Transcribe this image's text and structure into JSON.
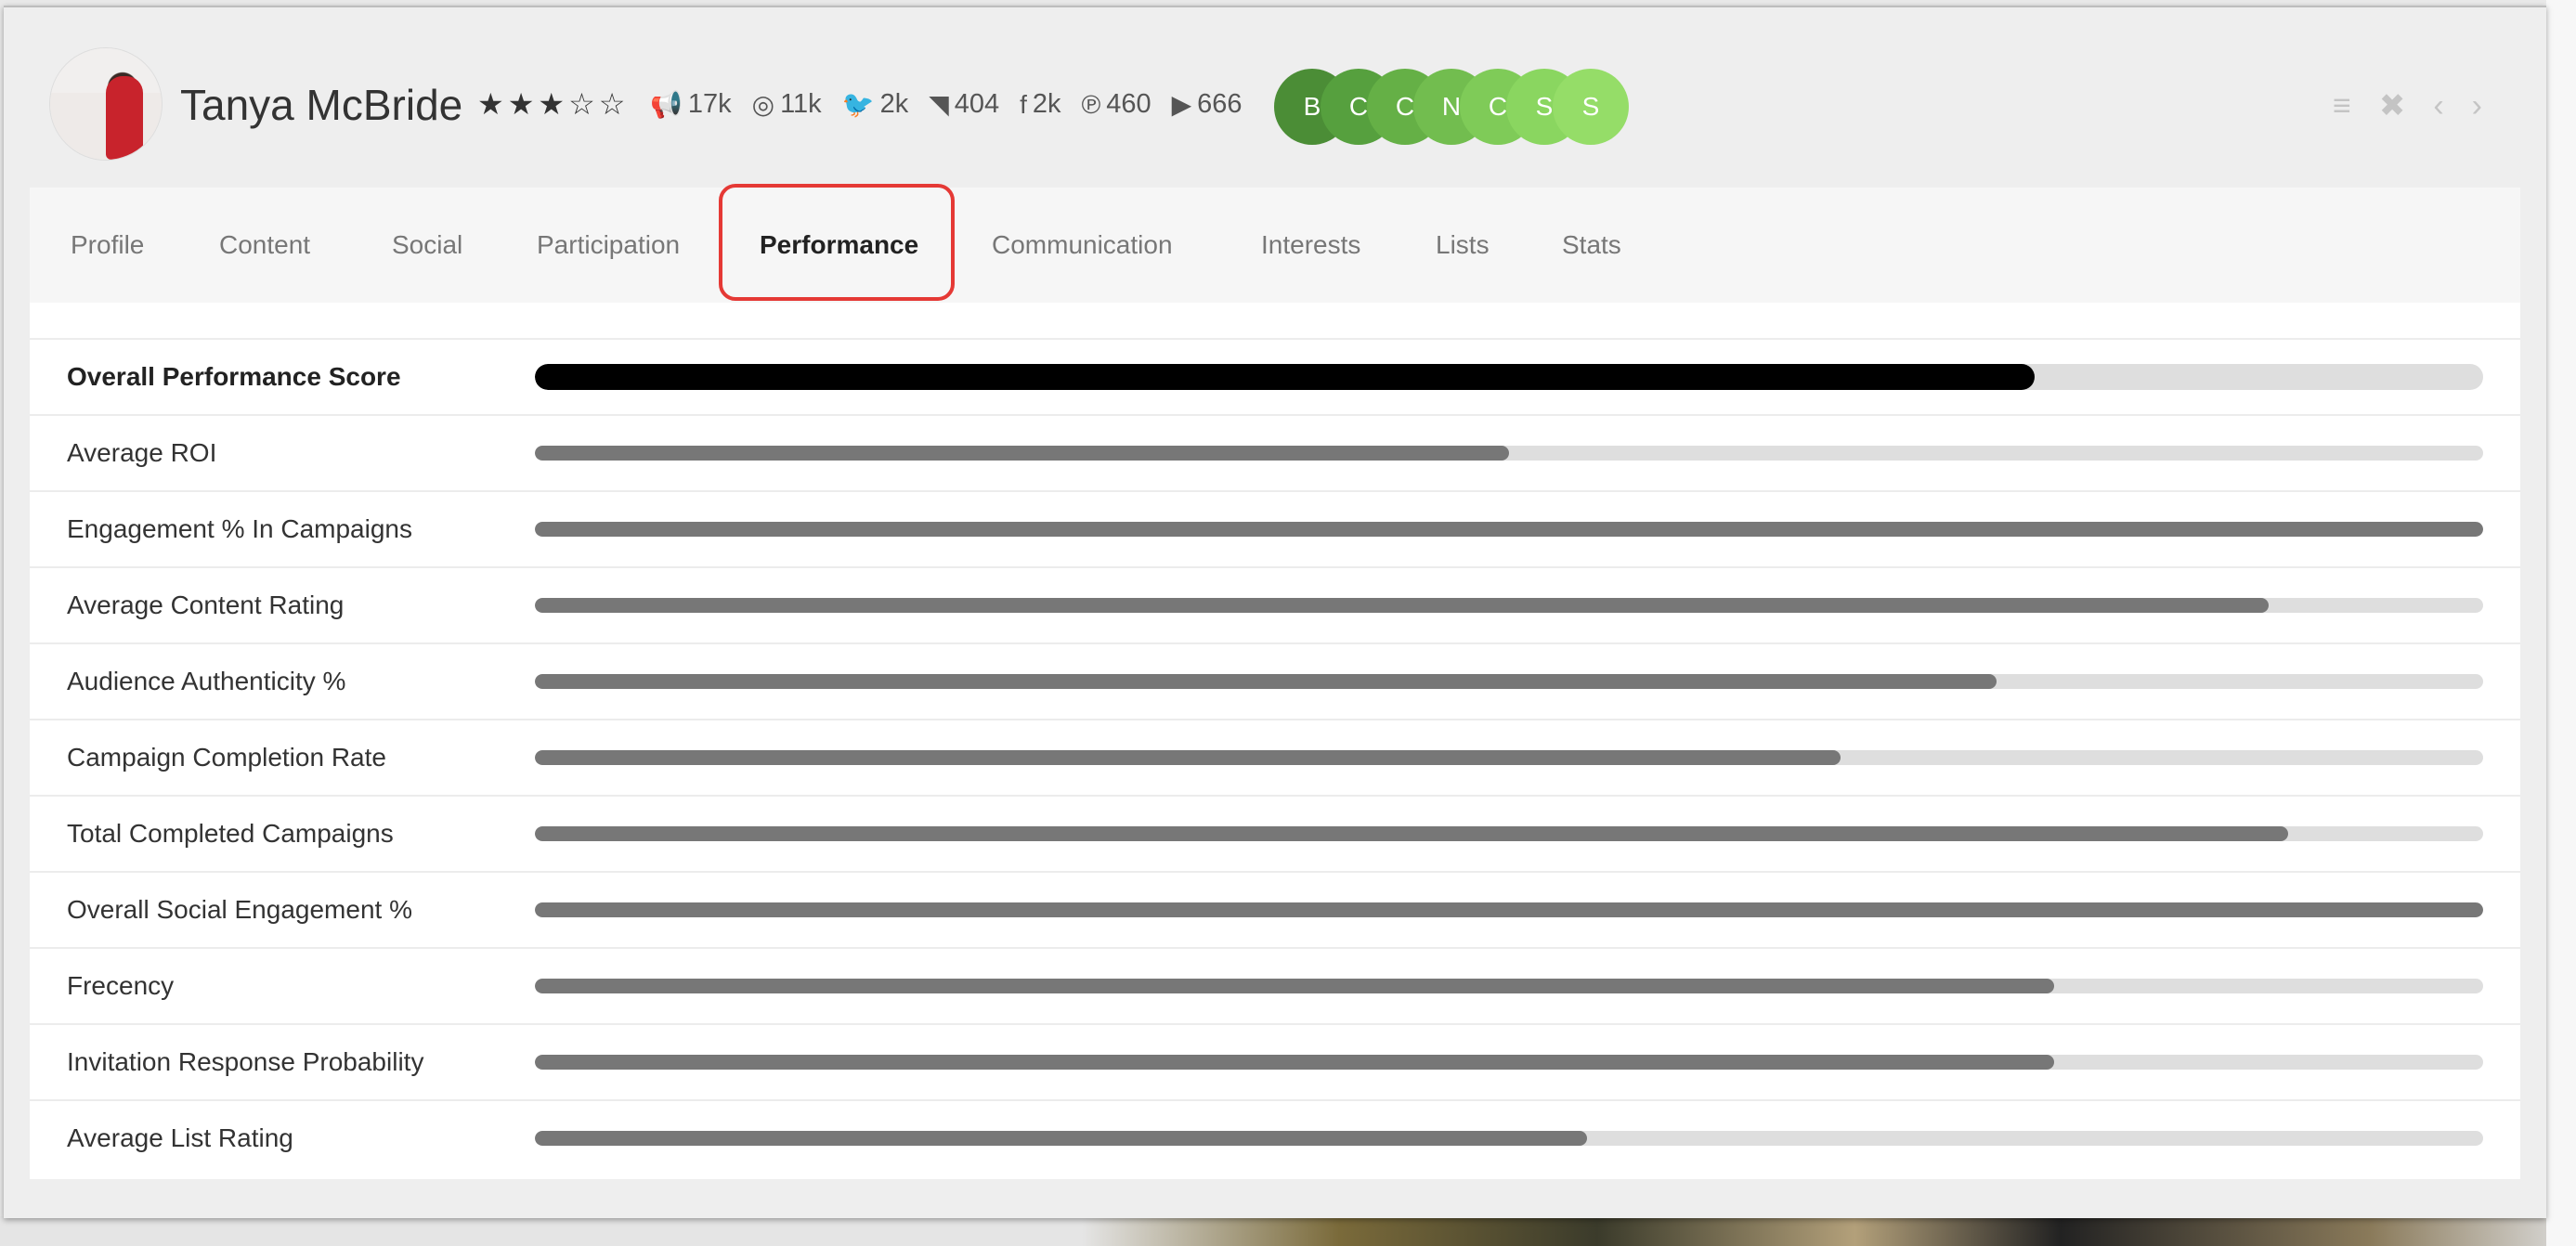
{
  "profile": {
    "name": "Tanya McBride",
    "rating_stars": 3,
    "rating_max": 5
  },
  "socials": [
    {
      "icon": "megaphone-icon",
      "glyph": "📢",
      "value": "17k"
    },
    {
      "icon": "instagram-icon",
      "glyph": "◎",
      "value": "11k"
    },
    {
      "icon": "twitter-icon",
      "glyph": "🐦",
      "value": "2k"
    },
    {
      "icon": "rss-icon",
      "glyph": "◥",
      "value": "404"
    },
    {
      "icon": "facebook-icon",
      "glyph": "f",
      "value": "2k"
    },
    {
      "icon": "pinterest-icon",
      "glyph": "℗",
      "value": "460"
    },
    {
      "icon": "youtube-icon",
      "glyph": "▶",
      "value": "666"
    }
  ],
  "badges": [
    {
      "letter": "B",
      "color": "#4b8d36"
    },
    {
      "letter": "C",
      "color": "#56a03e"
    },
    {
      "letter": "C",
      "color": "#65b046"
    },
    {
      "letter": "N",
      "color": "#72bd4f"
    },
    {
      "letter": "C",
      "color": "#7fcb58"
    },
    {
      "letter": "S",
      "color": "#8ad660"
    },
    {
      "letter": "S",
      "color": "#95dd68"
    }
  ],
  "window_controls": [
    {
      "name": "menu-icon",
      "glyph": "≡"
    },
    {
      "name": "close-icon",
      "glyph": "✖"
    },
    {
      "name": "prev-icon",
      "glyph": "‹"
    },
    {
      "name": "next-icon",
      "glyph": "›"
    }
  ],
  "tabs": [
    {
      "label": "Profile",
      "active": false
    },
    {
      "label": "Content",
      "active": false
    },
    {
      "label": "Social",
      "active": false
    },
    {
      "label": "Participation",
      "active": false
    },
    {
      "label": "Performance",
      "active": true
    },
    {
      "label": "Communication",
      "active": false
    },
    {
      "label": "Interests",
      "active": false
    },
    {
      "label": "Lists",
      "active": false
    },
    {
      "label": "Stats",
      "active": false
    }
  ],
  "metrics": [
    {
      "label": "Overall Performance Score",
      "value": 0.77,
      "overall": true
    },
    {
      "label": "Average ROI",
      "value": 0.5
    },
    {
      "label": "Engagement % In Campaigns",
      "value": 1.0
    },
    {
      "label": "Average Content Rating",
      "value": 0.89
    },
    {
      "label": "Audience Authenticity %",
      "value": 0.75
    },
    {
      "label": "Campaign Completion Rate",
      "value": 0.67
    },
    {
      "label": "Total Completed Campaigns",
      "value": 0.9
    },
    {
      "label": "Overall Social Engagement %",
      "value": 1.0
    },
    {
      "label": "Frecency",
      "value": 0.78
    },
    {
      "label": "Invitation Response Probability",
      "value": 0.78
    },
    {
      "label": "Average List Rating",
      "value": 0.54
    }
  ],
  "colors": {
    "active_tab_outline": "#e53935",
    "overall_bar": "#000000",
    "metric_bar": "#777777",
    "track": "#dedede"
  }
}
